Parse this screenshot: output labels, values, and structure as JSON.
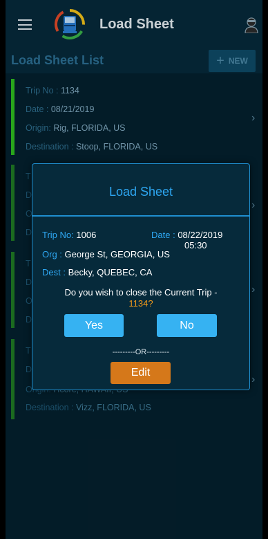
{
  "app_bar": {
    "title": "Load Sheet",
    "menu_icon": "menu-icon",
    "logo_icon": "truck-logo-icon",
    "profile_icon": "driver-profile-icon"
  },
  "list": {
    "title": "Load Sheet List",
    "new_button": {
      "icon": "plus-icon",
      "label": "NEW"
    },
    "trips": [
      {
        "trip_label": "Trip No :",
        "trip_no": "1134",
        "date_label": "Date :",
        "date": "08/21/2019",
        "origin_label": "Origin:",
        "origin": "Rig, FLORIDA, US",
        "destination_label": "Destination :",
        "destination": "Stoop, FLORIDA, US",
        "active": true
      },
      {
        "trip_label": "T",
        "date_label": "D",
        "origin_label": "O",
        "destination_label": "D",
        "active": false
      },
      {
        "trip_label": "T",
        "date_label": "D",
        "origin_label": "O",
        "destination_label": "D",
        "active": false
      },
      {
        "trip_label": "T",
        "date_label": "D",
        "origin_label": "Origin:",
        "origin": "Hcore, HAWAII, US",
        "destination_label": "Destination :",
        "destination": "Vizz, FLORIDA, US",
        "active": false
      }
    ]
  },
  "dialog": {
    "title": "Load Sheet",
    "trip_label": "Trip No:",
    "trip_no": "1006",
    "date_label": "Date :",
    "date": "08/22/2019",
    "time": "05:30",
    "org_label": "Org :",
    "org": "George St, GEORGIA, US",
    "dest_label": "Dest :",
    "dest": "Becky, QUEBEC, CA",
    "question": "Do you wish to close the Current Trip -",
    "question_trip": "1134?",
    "yes_label": "Yes",
    "no_label": "No",
    "or_text": "---------OR---------",
    "edit_label": "Edit"
  },
  "colors": {
    "background": "#04202e",
    "accent_blue": "#2ea7f2",
    "active_green": "#2fbf1f",
    "orange": "#d5781a"
  }
}
